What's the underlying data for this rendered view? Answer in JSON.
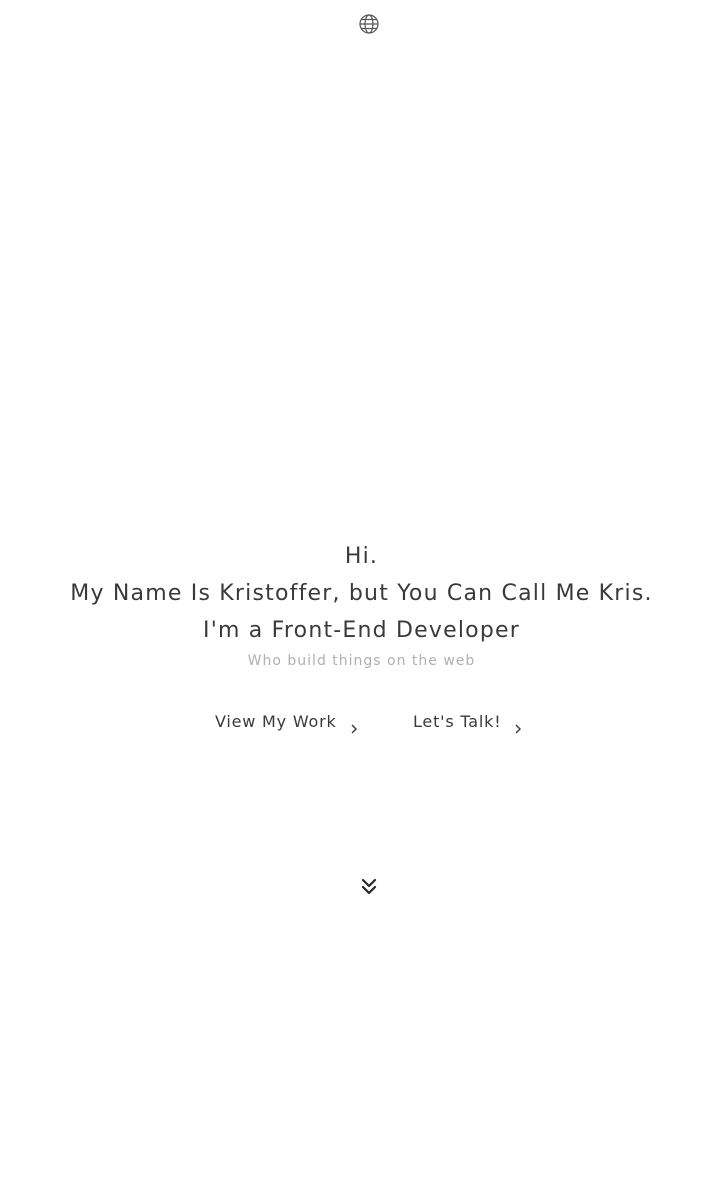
{
  "header": {
    "icon": "globe-icon"
  },
  "hero": {
    "greeting": "Hi.",
    "name_line": "My Name Is Kristoffer, but You Can Call Me Kris.",
    "role_line": "I'm a Front-End Developer",
    "subtitle": "Who build things on the web"
  },
  "actions": {
    "view_work_label": "View My Work",
    "lets_talk_label": "Let's Talk!",
    "chevron_icon": "chevron-right-icon"
  },
  "scroll": {
    "icon": "double-chevron-down-icon"
  },
  "colors": {
    "text": "#3a3a3a",
    "muted": "#b0b0b0",
    "background": "#ffffff"
  }
}
